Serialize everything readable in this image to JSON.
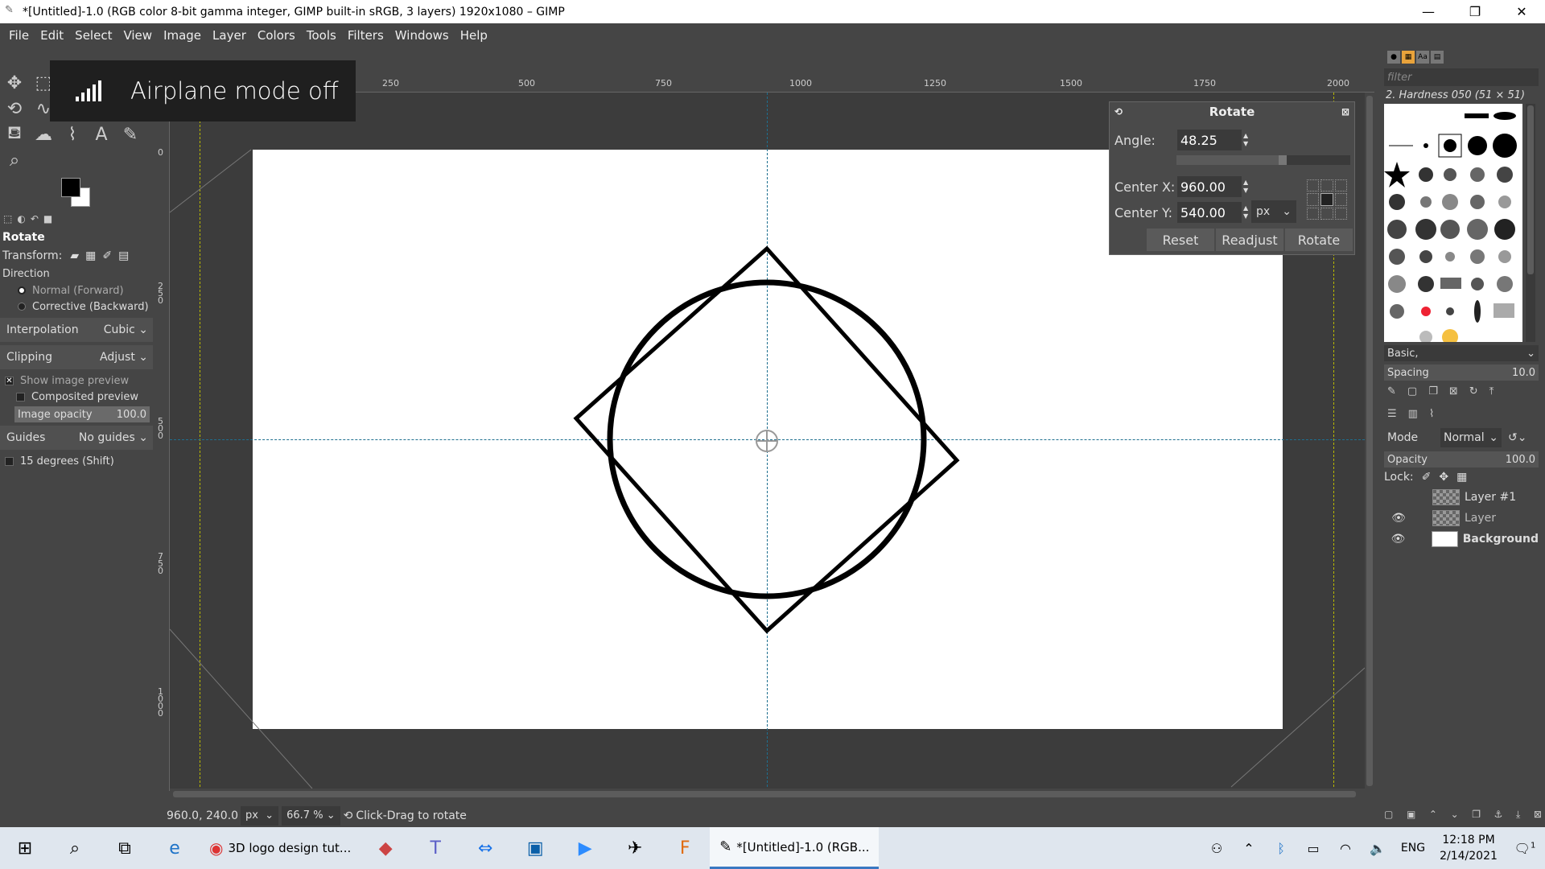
{
  "window": {
    "title": "*[Untitled]-1.0 (RGB color 8-bit gamma integer, GIMP built-in sRGB, 3 layers) 1920x1080 – GIMP"
  },
  "menu": [
    "File",
    "Edit",
    "Select",
    "View",
    "Image",
    "Layer",
    "Colors",
    "Tools",
    "Filters",
    "Windows",
    "Help"
  ],
  "toast": {
    "message": "Airplane mode off"
  },
  "tool_options": {
    "title": "Rotate",
    "transform_label": "Transform:",
    "direction_label": "Direction",
    "direction_normal": "Normal (Forward)",
    "direction_corrective": "Corrective (Backward)",
    "interpolation_label": "Interpolation",
    "interpolation_value": "Cubic",
    "clipping_label": "Clipping",
    "clipping_value": "Adjust",
    "show_preview": "Show image preview",
    "composited_preview": "Composited preview",
    "image_opacity_label": "Image opacity",
    "image_opacity_value": "100.0",
    "guides_label": "Guides",
    "guides_value": "No guides",
    "degrees_15": "15 degrees (Shift)"
  },
  "rulers": {
    "h": [
      "250",
      "500",
      "750",
      "1000",
      "1250",
      "1500",
      "1750",
      "2000"
    ],
    "v": [
      "0",
      "250",
      "500",
      "750",
      "1000"
    ]
  },
  "rotate_dialog": {
    "title": "Rotate",
    "angle_label": "Angle:",
    "angle_value": "48.25",
    "center_x_label": "Center X:",
    "center_x_value": "960.00",
    "center_y_label": "Center Y:",
    "center_y_value": "540.00",
    "unit": "px",
    "reset": "Reset",
    "readjust": "Readjust",
    "rotate": "Rotate",
    "angle_fraction": 0.61
  },
  "statusbar": {
    "coords": "960.0, 240.0",
    "unit": "px",
    "zoom": "66.7 %",
    "hint": "Click-Drag to rotate"
  },
  "brushes": {
    "filter_placeholder": "filter",
    "title": "2. Hardness 050 (51 × 51)",
    "tag": "Basic,",
    "spacing_label": "Spacing",
    "spacing_value": "10.0"
  },
  "layers": {
    "mode_label": "Mode",
    "mode_value": "Normal",
    "opacity_label": "Opacity",
    "opacity_value": "100.0",
    "lock_label": "Lock:",
    "items": [
      {
        "name": "Layer #1",
        "visible": false
      },
      {
        "name": "Layer",
        "visible": true
      },
      {
        "name": "Background",
        "visible": true
      }
    ]
  },
  "taskbar": {
    "chrome_app": "3D logo design tut...",
    "gimp_app": "*[Untitled]-1.0 (RGB...",
    "lang": "ENG",
    "time": "12:18 PM",
    "date": "2/14/2021",
    "notifications": "1"
  }
}
